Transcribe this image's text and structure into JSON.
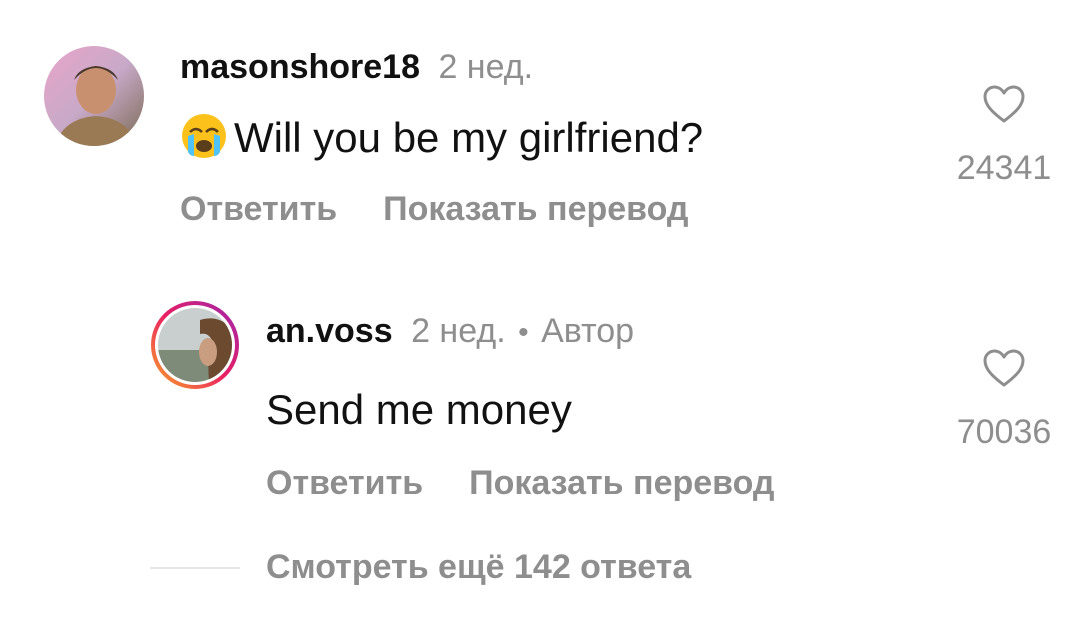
{
  "comments": [
    {
      "username": "masonshore18",
      "time": "2 нед.",
      "emoji": "crying-face-emoji",
      "text": "Will you be my girlfriend?",
      "reply_label": "Ответить",
      "translate_label": "Показать перевод",
      "likes": "24341"
    },
    {
      "username": "an.voss",
      "time": "2 нед.",
      "separator": "•",
      "author_badge": "Автор",
      "text": "Send me money",
      "reply_label": "Ответить",
      "translate_label": "Показать перевод",
      "likes": "70036"
    }
  ],
  "view_more_replies": "Смотреть ещё 142 ответа",
  "icons": {
    "like": "heart-outline-icon"
  },
  "colors": {
    "primary_text": "#111111",
    "secondary_text": "#8e8e8e",
    "story_ring_start": "#f9a825",
    "story_ring_end": "#c2185b"
  }
}
